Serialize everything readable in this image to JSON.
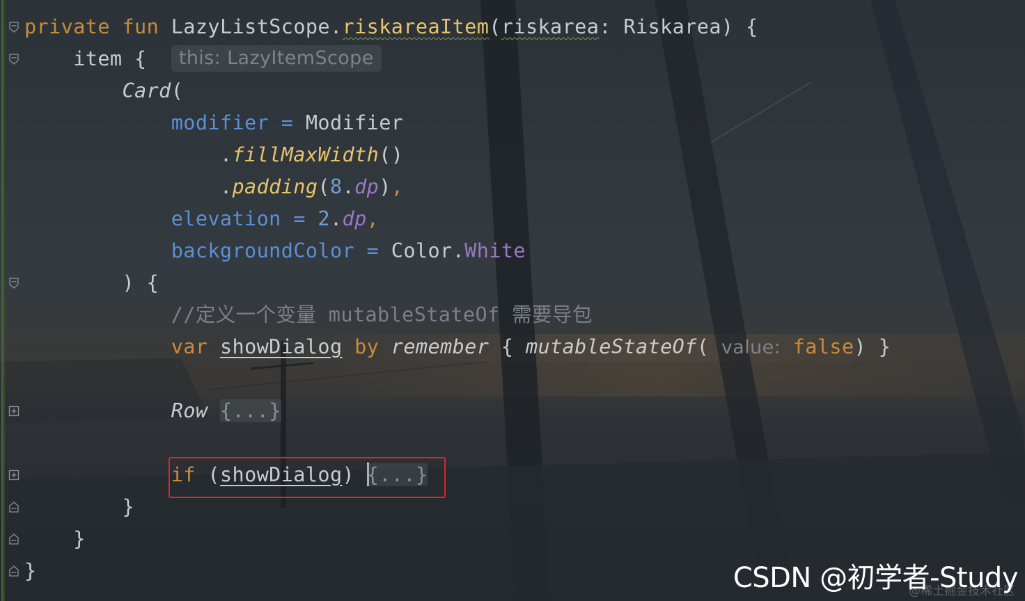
{
  "colors": {
    "keyword": "#cc8a3a",
    "function": "#e8c46a",
    "property": "#5b8fd6",
    "number": "#6f9ed6",
    "extension": "#9b78c4",
    "comment": "#7b8087",
    "highlight_border": "#d9262b"
  },
  "code": {
    "line1": {
      "kw_private": "private",
      "kw_fun": "fun",
      "receiver": "LazyListScope.",
      "fn_name": "riskareaItem",
      "open": "(",
      "param": "riskarea",
      "colon": ": Riskarea) {"
    },
    "line2": {
      "item": "item {",
      "hint": "this: LazyItemScope"
    },
    "line3": {
      "card": "Card",
      "open": "("
    },
    "line4": {
      "modifier": "modifier",
      "eq": " = ",
      "value": "Modifier"
    },
    "line5": {
      "dot": ".",
      "call": "fillMaxWidth",
      "parens": "()"
    },
    "line6": {
      "dot": ".",
      "call": "padding",
      "open": "(",
      "num": "8",
      "dot2": ".",
      "unit": "dp",
      "close": ")",
      "comma": ","
    },
    "line7": {
      "prop": "elevation",
      "eq": " = ",
      "num": "2",
      "dot": ".",
      "unit": "dp",
      "comma": ","
    },
    "line8": {
      "prop": "backgroundColor",
      "eq": " = ",
      "obj": "Color.",
      "member": "White"
    },
    "line9": {
      "text": ") {"
    },
    "line10": {
      "comment": "//定义一个变量 mutableStateOf 需要导包"
    },
    "line11": {
      "kw_var": "var",
      "name": "showDialog",
      "kw_by": "by",
      "call": "remember",
      "brace": " { ",
      "call2": "mutableStateOf",
      "open": "(",
      "hint": "value:",
      "kw_false": "false",
      "close": ") }"
    },
    "line12": {
      "comp": "Row",
      "collapsed": "{...}"
    },
    "line13": {
      "kw_if": "if",
      "open": " (",
      "name": "showDialog",
      "close": ") ",
      "collapsed": "{...}"
    },
    "line14": {
      "text": "}"
    },
    "line15": {
      "text": "}"
    },
    "line16": {
      "text": "}"
    }
  },
  "watermark": {
    "main": "CSDN @初学者-Study",
    "sub": "@稀土掘金技术社区"
  }
}
